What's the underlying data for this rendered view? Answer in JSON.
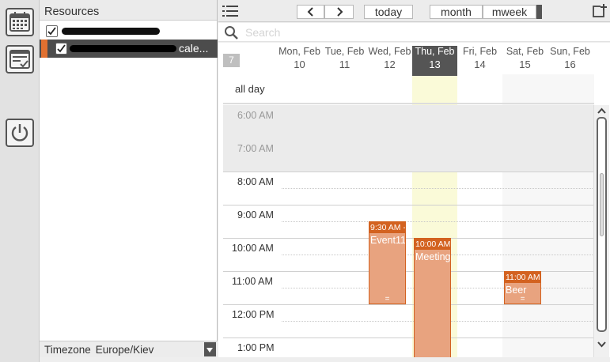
{
  "resources": {
    "title": "Resources",
    "items": [
      {
        "label": "",
        "checked": true,
        "color": "#ffffff"
      },
      {
        "label": "cale...",
        "checked": true,
        "color": "#e07030"
      }
    ]
  },
  "timezone": {
    "label": "Timezone",
    "value": "Europe/Kiev"
  },
  "toolbar": {
    "today_label": "today",
    "month_label": "month",
    "mweek_label": "mweek"
  },
  "search": {
    "placeholder": "Search"
  },
  "week_number": "7",
  "days": [
    {
      "name": "Mon, Feb",
      "num": "10",
      "today": false
    },
    {
      "name": "Tue, Feb",
      "num": "11",
      "today": false
    },
    {
      "name": "Wed, Feb",
      "num": "12",
      "today": false
    },
    {
      "name": "Thu, Feb",
      "num": "13",
      "today": true
    },
    {
      "name": "Fri, Feb",
      "num": "14",
      "today": false
    },
    {
      "name": "Sat, Feb",
      "num": "15",
      "today": false
    },
    {
      "name": "Sun, Feb",
      "num": "16",
      "today": false
    }
  ],
  "allday_label": "all day",
  "hours": [
    "6:00 AM",
    "7:00 AM",
    "8:00 AM",
    "9:00 AM",
    "10:00 AM",
    "11:00 AM",
    "12:00 PM",
    "1:00 PM"
  ],
  "events": [
    {
      "time": "9:30 AM -",
      "title": "Event11",
      "day": "Wed, Feb 12"
    },
    {
      "time": "10:00 AM",
      "title": "Meeting",
      "day": "Thu, Feb 13"
    },
    {
      "time": "11:00 AM",
      "title": "Beer",
      "day": "Sat, Feb 15"
    }
  ],
  "colors": {
    "accent": "#d36220",
    "event_fill": "#e8a37f",
    "today_column": "#fafad8",
    "selected_row": "#4c4c4c"
  }
}
